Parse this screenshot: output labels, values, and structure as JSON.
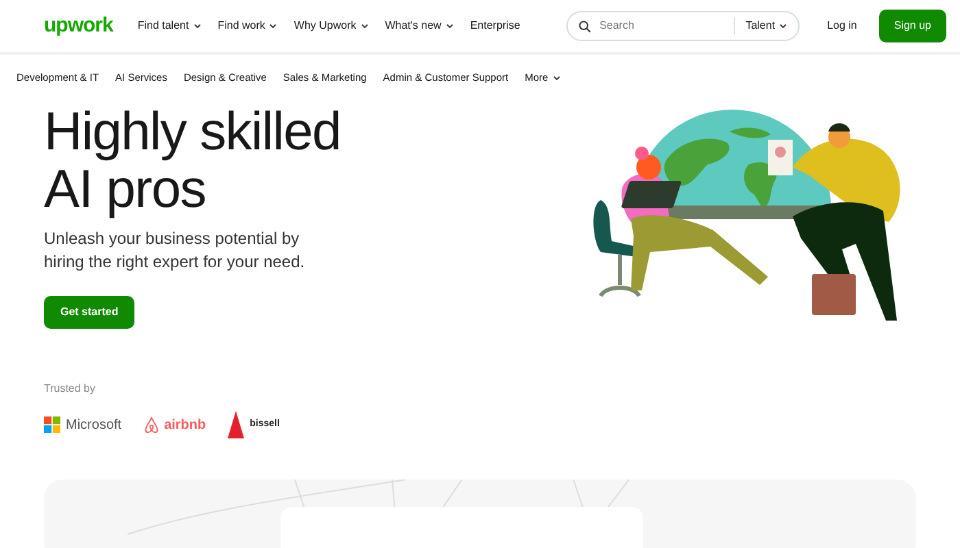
{
  "header": {
    "logo": "upwork",
    "nav": [
      {
        "label": "Find talent",
        "dropdown": true
      },
      {
        "label": "Find work",
        "dropdown": true
      },
      {
        "label": "Why Upwork",
        "dropdown": true
      },
      {
        "label": "What's new",
        "dropdown": true
      },
      {
        "label": "Enterprise",
        "dropdown": false
      }
    ],
    "search": {
      "placeholder": "Search",
      "scope": "Talent"
    },
    "login": "Log in",
    "signup": "Sign up"
  },
  "categories": [
    {
      "label": "Development & IT",
      "dropdown": false
    },
    {
      "label": "AI Services",
      "dropdown": false
    },
    {
      "label": "Design & Creative",
      "dropdown": false
    },
    {
      "label": "Sales & Marketing",
      "dropdown": false
    },
    {
      "label": "Admin & Customer Support",
      "dropdown": false
    },
    {
      "label": "More",
      "dropdown": true
    }
  ],
  "hero": {
    "title": "Highly skilled AI pros",
    "subtitle": "Unleash your business potential by hiring the right expert for your need.",
    "cta": "Get started"
  },
  "trusted": {
    "label": "Trusted by",
    "logos": [
      {
        "kind": "microsoft",
        "name": "Microsoft"
      },
      {
        "kind": "airbnb",
        "name": "airbnb"
      },
      {
        "kind": "bissell",
        "name": "bissell"
      }
    ]
  }
}
